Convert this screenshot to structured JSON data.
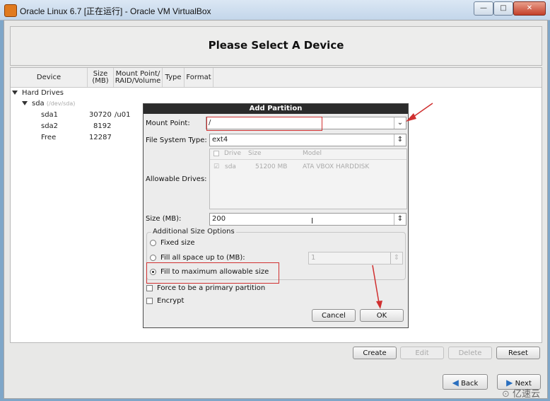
{
  "window": {
    "title": "Oracle Linux 6.7 [正在运行] - Oracle VM VirtualBox",
    "min_label": "—",
    "max_label": "□",
    "close_label": "✕"
  },
  "page": {
    "title": "Please Select A Device"
  },
  "table": {
    "columns": [
      "Device",
      "Size\n(MB)",
      "Mount Point/\nRAID/Volume",
      "Type",
      "Format"
    ],
    "tree": {
      "hard_drives_label": "Hard Drives",
      "disk_label": "sda",
      "disk_path": "(/dev/sda)",
      "partitions": [
        {
          "name": "sda1",
          "size": "30720",
          "mount": "/u01"
        },
        {
          "name": "sda2",
          "size": "8192",
          "mount": ""
        },
        {
          "name": "Free",
          "size": "12287",
          "mount": ""
        }
      ]
    }
  },
  "main_buttons": {
    "create": "Create",
    "edit": "Edit",
    "delete": "Delete",
    "reset": "Reset",
    "back": "Back",
    "next": "Next"
  },
  "dialog": {
    "title": "Add Partition",
    "mount_point_label": "Mount Point:",
    "mount_point_value": "/",
    "fs_type_label": "File System Type:",
    "fs_type_value": "ext4",
    "allowable_drives_label": "Allowable Drives:",
    "drives_columns": [
      "Drive",
      "Size",
      "Model"
    ],
    "drives_rows": [
      {
        "drive": "sda",
        "size": "51200 MB",
        "model": "ATA VBOX HARDDISK",
        "checked": true
      }
    ],
    "size_label": "Size (MB):",
    "size_value": "200",
    "additional_options_label": "Additional Size Options",
    "option_fixed": "Fixed size",
    "option_fill_upto": "Fill all space up to (MB):",
    "fill_upto_value": "1",
    "option_fill_max": "Fill to maximum allowable size",
    "selected_option": "Fill to maximum allowable size",
    "force_primary_label": "Force to be a primary partition",
    "encrypt_label": "Encrypt",
    "cancel_label": "Cancel",
    "ok_label": "OK"
  },
  "watermark": {
    "text": "亿速云"
  },
  "colors": {
    "annotation_red": "#d03030",
    "dialog_title_bg": "#2b2b2b"
  }
}
